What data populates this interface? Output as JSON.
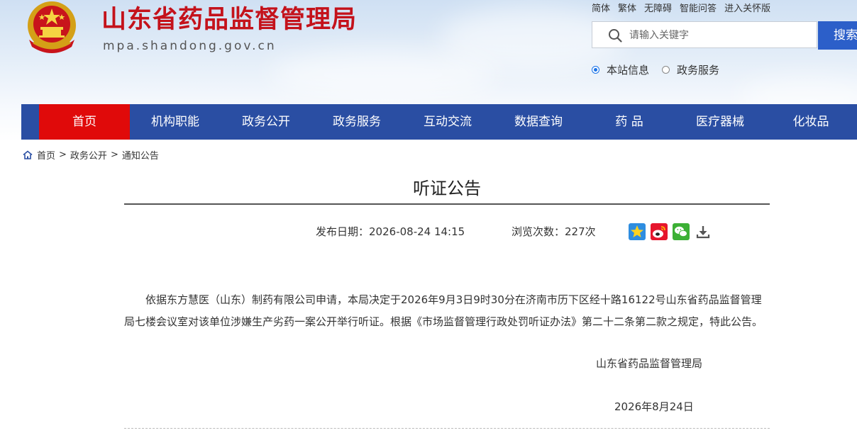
{
  "header": {
    "site_title": "山东省药品监督管理局",
    "site_domain": "mpa.shandong.gov.cn",
    "top_links": [
      "简体",
      "繁体",
      "无障碍",
      "智能问答",
      "进入关怀版"
    ],
    "search_placeholder": "请输入关键字",
    "search_button": "搜索",
    "scope_options": [
      {
        "label": "本站信息",
        "selected": true
      },
      {
        "label": "政务服务",
        "selected": false
      }
    ]
  },
  "nav": {
    "items": [
      "首页",
      "机构职能",
      "政务公开",
      "政务服务",
      "互动交流",
      "数据查询",
      "药 品",
      "医疗器械",
      "化妆品"
    ],
    "active_index": 0
  },
  "breadcrumb": [
    "首页",
    "政务公开",
    "通知公告"
  ],
  "article": {
    "title": "听证公告",
    "publish_label": "发布日期：",
    "publish_date": "2026-08-24 14:15",
    "views_label": "浏览次数：",
    "views": "227次",
    "body": "依据东方慧医（山东）制药有限公司申请，本局决定于2026年9月3日9时30分在济南市历下区经十路16122号山东省药品监督管理局七楼会议室对该单位涉嫌生产劣药一案公开举行听证。根据《市场监督管理行政处罚听证办法》第二十二条第二款之规定，特此公告。",
    "signature": "山东省药品监督管理局",
    "sign_date": "2026年8月24日"
  },
  "share_icons": [
    "qzone-icon",
    "weibo-icon",
    "wechat-icon",
    "download-icon"
  ],
  "colors": {
    "brand_red": "#c4121b",
    "nav_blue": "#2a4ea3",
    "nav_active": "#e00a0a",
    "search_blue": "#2c5fc9"
  }
}
